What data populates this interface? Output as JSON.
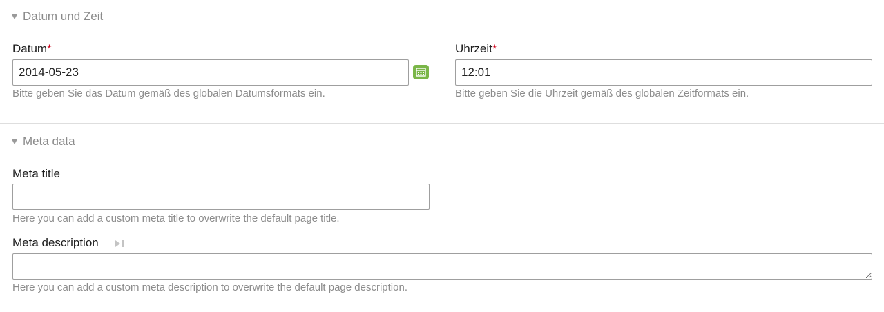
{
  "sections": {
    "datetime": {
      "title": "Datum und Zeit",
      "date": {
        "label": "Datum",
        "required_mark": "*",
        "value": "2014-05-23",
        "help": "Bitte geben Sie das Datum gemäß des globalen Datumsformats ein."
      },
      "time": {
        "label": "Uhrzeit",
        "required_mark": "*",
        "value": "12:01",
        "help": "Bitte geben Sie die Uhrzeit gemäß des globalen Zeitformats ein."
      },
      "calendar_icon": "calendar-icon"
    },
    "meta": {
      "title": "Meta data",
      "meta_title": {
        "label": "Meta title",
        "value": "",
        "help": "Here you can add a custom meta title to overwrite the default page title."
      },
      "meta_description": {
        "label": "Meta description",
        "value": "",
        "help": "Here you can add a custom meta description to overwrite the default page description.",
        "toggle_icon": "play-pause-icon"
      }
    }
  },
  "colors": {
    "required": "#d0021b",
    "calendar_button": "#7ab648",
    "help_text": "#8c8c8c",
    "section_title": "#8a8a8a"
  }
}
